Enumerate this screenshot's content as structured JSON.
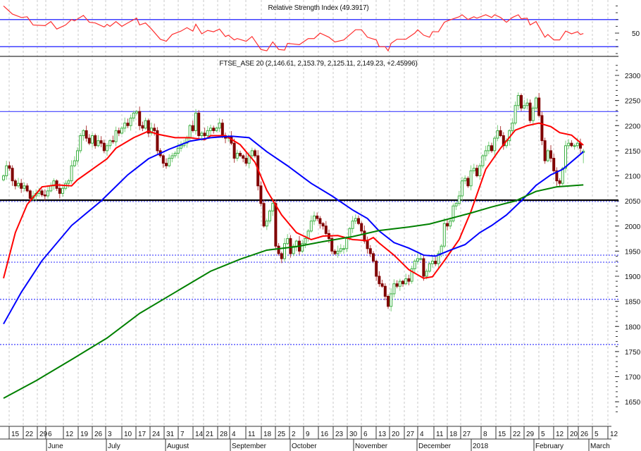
{
  "rsi_title": "Relative Strength Index (49.3917)",
  "price_title": "FTSE_ASE 20 (2,146.61, 2,153.79, 2,125.11, 2,149.23, +2.45996)",
  "colors": {
    "up": "#3cb043",
    "down": "#800000",
    "ma20": "#ff0000",
    "ma50": "#0000ff",
    "ma200": "#008000",
    "rsi": "#ff3030",
    "level": "#4040ff",
    "support": "#000000"
  },
  "chart_data": [
    {
      "type": "line",
      "title": "Relative Strength Index (49.3917)",
      "ylim": [
        20,
        92
      ],
      "y_ticks": [
        "50"
      ],
      "levels": [
        70,
        30
      ],
      "series": [
        {
          "name": "RSI",
          "points": [
            [
              0,
              90
            ],
            [
              3,
              78
            ],
            [
              6,
              73
            ],
            [
              8,
              74
            ],
            [
              10,
              62
            ],
            [
              14,
              61
            ],
            [
              16,
              67
            ],
            [
              18,
              56
            ],
            [
              21,
              62
            ],
            [
              23,
              70
            ],
            [
              24,
              68
            ],
            [
              27,
              76
            ],
            [
              29,
              66
            ],
            [
              31,
              65
            ],
            [
              34,
              59
            ],
            [
              35,
              63
            ],
            [
              36,
              60
            ],
            [
              38,
              67
            ],
            [
              40,
              60
            ],
            [
              42,
              65
            ],
            [
              45,
              72
            ],
            [
              46,
              62
            ],
            [
              48,
              65
            ],
            [
              50,
              56
            ],
            [
              53,
              41
            ],
            [
              55,
              38
            ],
            [
              57,
              48
            ],
            [
              60,
              53
            ],
            [
              62,
              58
            ],
            [
              64,
              53
            ],
            [
              65,
              63
            ],
            [
              67,
              49
            ],
            [
              69,
              54
            ],
            [
              71,
              52
            ],
            [
              73,
              56
            ],
            [
              75,
              45
            ],
            [
              76,
              47
            ],
            [
              78,
              40
            ],
            [
              79,
              42
            ],
            [
              82,
              38
            ],
            [
              84,
              45
            ],
            [
              87,
              26
            ],
            [
              89,
              24
            ],
            [
              91,
              37
            ],
            [
              93,
              26
            ],
            [
              95,
              25
            ],
            [
              96,
              35
            ],
            [
              98,
              34
            ],
            [
              100,
              33
            ],
            [
              103,
              42
            ],
            [
              105,
              42
            ],
            [
              107,
              50
            ],
            [
              110,
              44
            ],
            [
              112,
              37
            ],
            [
              115,
              40
            ],
            [
              119,
              55
            ],
            [
              121,
              55
            ],
            [
              123,
              44
            ],
            [
              126,
              40
            ],
            [
              127,
              30
            ],
            [
              129,
              30
            ],
            [
              130,
              24
            ],
            [
              131,
              35
            ],
            [
              133,
              41
            ],
            [
              136,
              41
            ],
            [
              137,
              44
            ],
            [
              139,
              50
            ],
            [
              140,
              55
            ],
            [
              142,
              47
            ],
            [
              144,
              44
            ],
            [
              145,
              52
            ],
            [
              147,
              52
            ],
            [
              149,
              66
            ],
            [
              150,
              68
            ],
            [
              152,
              71
            ],
            [
              154,
              74
            ],
            [
              155,
              77
            ],
            [
              157,
              70
            ],
            [
              159,
              74
            ],
            [
              160,
              72
            ],
            [
              163,
              77
            ],
            [
              165,
              73
            ],
            [
              166,
              77
            ],
            [
              168,
              73
            ],
            [
              170,
              66
            ],
            [
              172,
              73
            ],
            [
              174,
              77
            ],
            [
              175,
              71
            ],
            [
              177,
              72
            ],
            [
              178,
              62
            ],
            [
              180,
              67
            ],
            [
              183,
              44
            ],
            [
              184,
              48
            ],
            [
              186,
              40
            ],
            [
              188,
              40
            ],
            [
              190,
              53
            ],
            [
              192,
              49
            ],
            [
              194,
              52
            ],
            [
              195,
              48
            ],
            [
              196,
              49.39
            ]
          ]
        }
      ]
    },
    {
      "type": "candlestick",
      "title": "FTSE_ASE 20 (2,146.61, 2,153.79, 2,125.11, 2,149.23, +2.45996)",
      "ylim": [
        1620,
        2320
      ],
      "y_ticks": [
        "2300",
        "2250",
        "2200",
        "2150",
        "2100",
        "2050",
        "2000",
        "1950",
        "1900",
        "1850",
        "1800",
        "1750",
        "1700",
        "1650"
      ],
      "closes": [
        2100,
        2120,
        2115,
        2090,
        2080,
        2085,
        2075,
        2080,
        2070,
        2055,
        2060,
        2065,
        2070,
        2062,
        2060,
        2070,
        2080,
        2090,
        2075,
        2065,
        2075,
        2085,
        2090,
        2120,
        2130,
        2150,
        2180,
        2190,
        2175,
        2165,
        2180,
        2160,
        2170,
        2165,
        2150,
        2160,
        2170,
        2168,
        2190,
        2185,
        2195,
        2205,
        2200,
        2215,
        2225,
        2228,
        2200,
        2195,
        2210,
        2185,
        2195,
        2190,
        2150,
        2140,
        2125,
        2120,
        2135,
        2140,
        2145,
        2155,
        2160,
        2165,
        2175,
        2200,
        2190,
        2225,
        2180,
        2185,
        2180,
        2190,
        2195,
        2190,
        2195,
        2205,
        2180,
        2175,
        2178,
        2165,
        2135,
        2145,
        2140,
        2135,
        2125,
        2140,
        2150,
        2140,
        2080,
        2045,
        2000,
        2010,
        2030,
        2045,
        1960,
        1945,
        1935,
        1965,
        1975,
        1945,
        1960,
        1970,
        1950,
        1965,
        1975,
        1990,
        2010,
        2020,
        2015,
        2005,
        2000,
        1985,
        1975,
        1950,
        1945,
        1950,
        1955,
        1955,
        1975,
        1995,
        2010,
        2015,
        2005,
        1990,
        1970,
        1955,
        1945,
        1930,
        1900,
        1885,
        1880,
        1860,
        1840,
        1865,
        1885,
        1880,
        1890,
        1885,
        1895,
        1890,
        1915,
        1930,
        1935,
        1935,
        1900,
        1910,
        1925,
        1930,
        1925,
        1945,
        1960,
        2005,
        2000,
        2010,
        2040,
        2045,
        2060,
        2090,
        2095,
        2080,
        2110,
        2115,
        2100,
        2120,
        2140,
        2150,
        2160,
        2150,
        2175,
        2190,
        2180,
        2160,
        2170,
        2190,
        2205,
        2240,
        2260,
        2235,
        2240,
        2245,
        2210,
        2235,
        2255,
        2220,
        2170,
        2130,
        2150,
        2135,
        2110,
        2090,
        2085,
        2115,
        2160,
        2165,
        2160,
        2160,
        2165,
        2155,
        2149.23
      ],
      "last_ohlc": {
        "open": 2146.61,
        "high": 2153.79,
        "low": 2125.11,
        "close": 2149.23,
        "change": 2.45996
      },
      "horizontal_lines": [
        {
          "value": 2228,
          "style": "solid",
          "color": "level"
        },
        {
          "value": 2051.5,
          "style": "solid",
          "color": "support"
        },
        {
          "value": 1942,
          "style": "dotted",
          "color": "level"
        },
        {
          "value": 1928,
          "style": "dotted",
          "color": "level"
        },
        {
          "value": 1854,
          "style": "dotted",
          "color": "level"
        },
        {
          "value": 1764,
          "style": "dotted",
          "color": "level"
        }
      ],
      "series": [
        {
          "name": "MA20",
          "color": "ma20",
          "points": [
            [
              0,
              1896
            ],
            [
              4,
              1987
            ],
            [
              8,
              2043
            ],
            [
              13,
              2078
            ],
            [
              18,
              2082
            ],
            [
              23,
              2080
            ],
            [
              25,
              2092
            ],
            [
              30,
              2113
            ],
            [
              35,
              2134
            ],
            [
              38,
              2155
            ],
            [
              44,
              2176
            ],
            [
              49,
              2189
            ],
            [
              52,
              2183
            ],
            [
              58,
              2176
            ],
            [
              63,
              2176
            ],
            [
              68,
              2172
            ],
            [
              70,
              2180
            ],
            [
              75,
              2180
            ],
            [
              80,
              2162
            ],
            [
              85,
              2127
            ],
            [
              89,
              2071
            ],
            [
              94,
              2022
            ],
            [
              99,
              1987
            ],
            [
              104,
              1973
            ],
            [
              108,
              1980
            ],
            [
              113,
              1981
            ],
            [
              118,
              1973
            ],
            [
              123,
              1971
            ],
            [
              125,
              1977
            ],
            [
              127,
              1966
            ],
            [
              132,
              1942
            ],
            [
              137,
              1913
            ],
            [
              142,
              1896
            ],
            [
              145,
              1899
            ],
            [
              149,
              1931
            ],
            [
              154,
              1973
            ],
            [
              158,
              2029
            ],
            [
              163,
              2113
            ],
            [
              168,
              2155
            ],
            [
              173,
              2191
            ],
            [
              177,
              2200
            ],
            [
              181,
              2205
            ],
            [
              185,
              2198
            ],
            [
              188,
              2186
            ],
            [
              192,
              2181
            ],
            [
              196,
              2161
            ]
          ]
        },
        {
          "name": "MA50",
          "color": "ma50",
          "points": [
            [
              0,
              1805
            ],
            [
              6,
              1868
            ],
            [
              13,
              1931
            ],
            [
              23,
              2001
            ],
            [
              33,
              2050
            ],
            [
              42,
              2102
            ],
            [
              49,
              2134
            ],
            [
              56,
              2153
            ],
            [
              63,
              2169
            ],
            [
              70,
              2176
            ],
            [
              77,
              2179
            ],
            [
              83,
              2176
            ],
            [
              89,
              2148
            ],
            [
              96,
              2120
            ],
            [
              104,
              2085
            ],
            [
              111,
              2060
            ],
            [
              118,
              2032
            ],
            [
              123,
              2015
            ],
            [
              127,
              1990
            ],
            [
              132,
              1967
            ],
            [
              137,
              1956
            ],
            [
              142,
              1942
            ],
            [
              146,
              1940
            ],
            [
              151,
              1952
            ],
            [
              156,
              1963
            ],
            [
              161,
              1987
            ],
            [
              165,
              2001
            ],
            [
              170,
              2022
            ],
            [
              175,
              2050
            ],
            [
              180,
              2081
            ],
            [
              185,
              2102
            ],
            [
              189,
              2113
            ],
            [
              196,
              2148
            ]
          ]
        },
        {
          "name": "MA200",
          "color": "ma200",
          "points": [
            [
              0,
              1657
            ],
            [
              11,
              1692
            ],
            [
              23,
              1734
            ],
            [
              35,
              1777
            ],
            [
              46,
              1826
            ],
            [
              58,
              1868
            ],
            [
              70,
              1910
            ],
            [
              80,
              1934
            ],
            [
              89,
              1952
            ],
            [
              99,
              1959
            ],
            [
              108,
              1969
            ],
            [
              118,
              1979
            ],
            [
              127,
              1991
            ],
            [
              137,
              1998
            ],
            [
              144,
              2004
            ],
            [
              151,
              2015
            ],
            [
              158,
              2026
            ],
            [
              165,
              2038
            ],
            [
              173,
              2050
            ],
            [
              180,
              2069
            ],
            [
              187,
              2078
            ],
            [
              196,
              2082
            ]
          ]
        }
      ],
      "x_tick_labels": [
        "15",
        "22",
        "29",
        "6",
        "12",
        "19",
        "26",
        "3",
        "10",
        "17",
        "24",
        "31",
        "7",
        "14",
        "21",
        "28",
        "4",
        "11",
        "18",
        "25",
        "2",
        "9",
        "16",
        "23",
        "30",
        "6",
        "13",
        "20",
        "27",
        "4",
        "11",
        "18",
        "27",
        "8",
        "15",
        "22",
        "29",
        "5",
        "12",
        "20",
        "26",
        "5",
        "12"
      ],
      "x_month_labels": [
        "June",
        "July",
        "August",
        "September",
        "October",
        "November",
        "December",
        "2018",
        "February",
        "March"
      ]
    }
  ]
}
